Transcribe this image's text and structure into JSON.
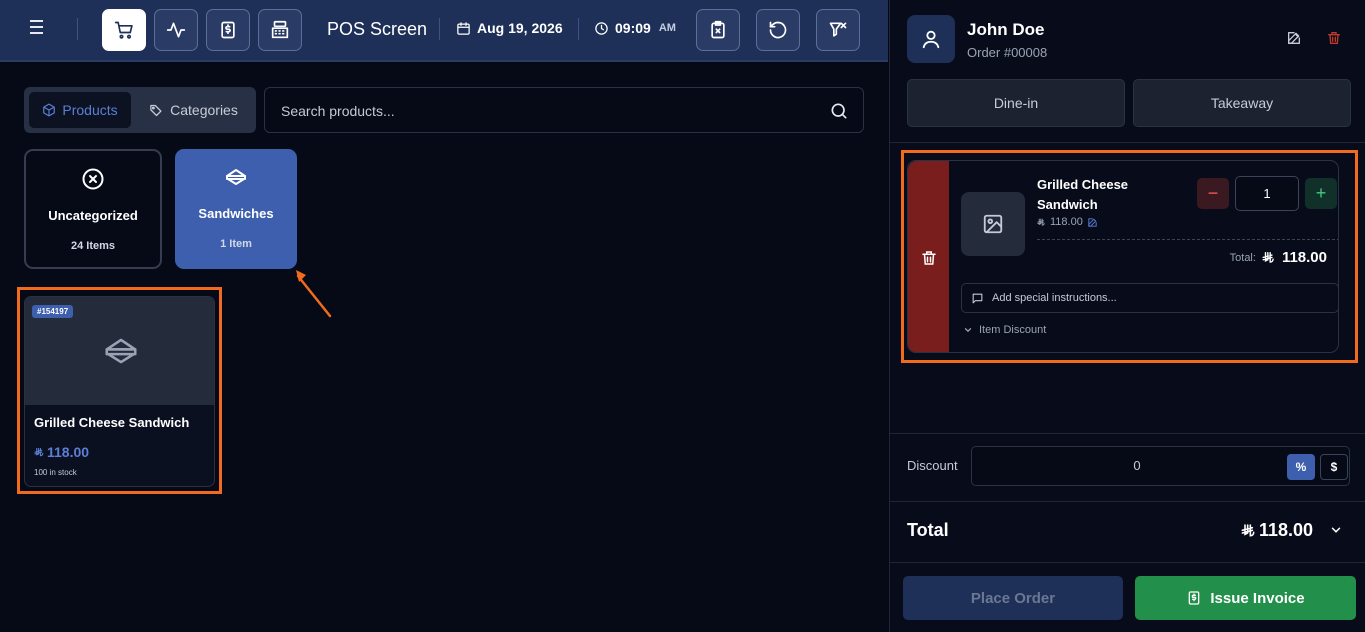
{
  "topbar": {
    "title": "POS Screen",
    "date": "Aug 19, 2026",
    "time": "09:09",
    "ampm": "AM",
    "icons": [
      "menu-icon",
      "cart-icon",
      "activity-icon",
      "cash-icon",
      "register-icon",
      "clipboard-x-icon",
      "reset-icon",
      "filter-x-icon"
    ]
  },
  "view_toggle": {
    "products_label": "Products",
    "categories_label": "Categories",
    "selected": "Products"
  },
  "search": {
    "placeholder": "Search products..."
  },
  "categories": [
    {
      "name": "Uncategorized",
      "count": "24 Items",
      "selected": false
    },
    {
      "name": "Sandwiches",
      "count": "1 Item",
      "selected": true
    }
  ],
  "products": [
    {
      "id": "#154197",
      "name": "Grilled Cheese Sandwich",
      "price": "118.00",
      "stock": "100 in stock"
    }
  ],
  "order": {
    "customer": "John Doe",
    "order_no": "Order #00008",
    "mode_dine_in": "Dine-in",
    "mode_takeaway": "Takeaway",
    "items": [
      {
        "name": "Grilled Cheese Sandwich",
        "unit_price": "118.00",
        "qty": "1",
        "total_label": "Total:",
        "total": "118.00",
        "instructions_placeholder": "Add special instructions...",
        "discount_toggle": "Item Discount"
      }
    ],
    "discount_label": "Discount",
    "discount_value": "0",
    "discount_pct": "%",
    "discount_usd": "$",
    "total_label": "Total",
    "total": "118.00",
    "place_order": "Place Order",
    "issue_invoice": "Issue Invoice"
  },
  "colors": {
    "accent": "#3d5fae",
    "highlight": "#f26a1b",
    "success": "#22904a",
    "danger": "#7a1d1d"
  }
}
